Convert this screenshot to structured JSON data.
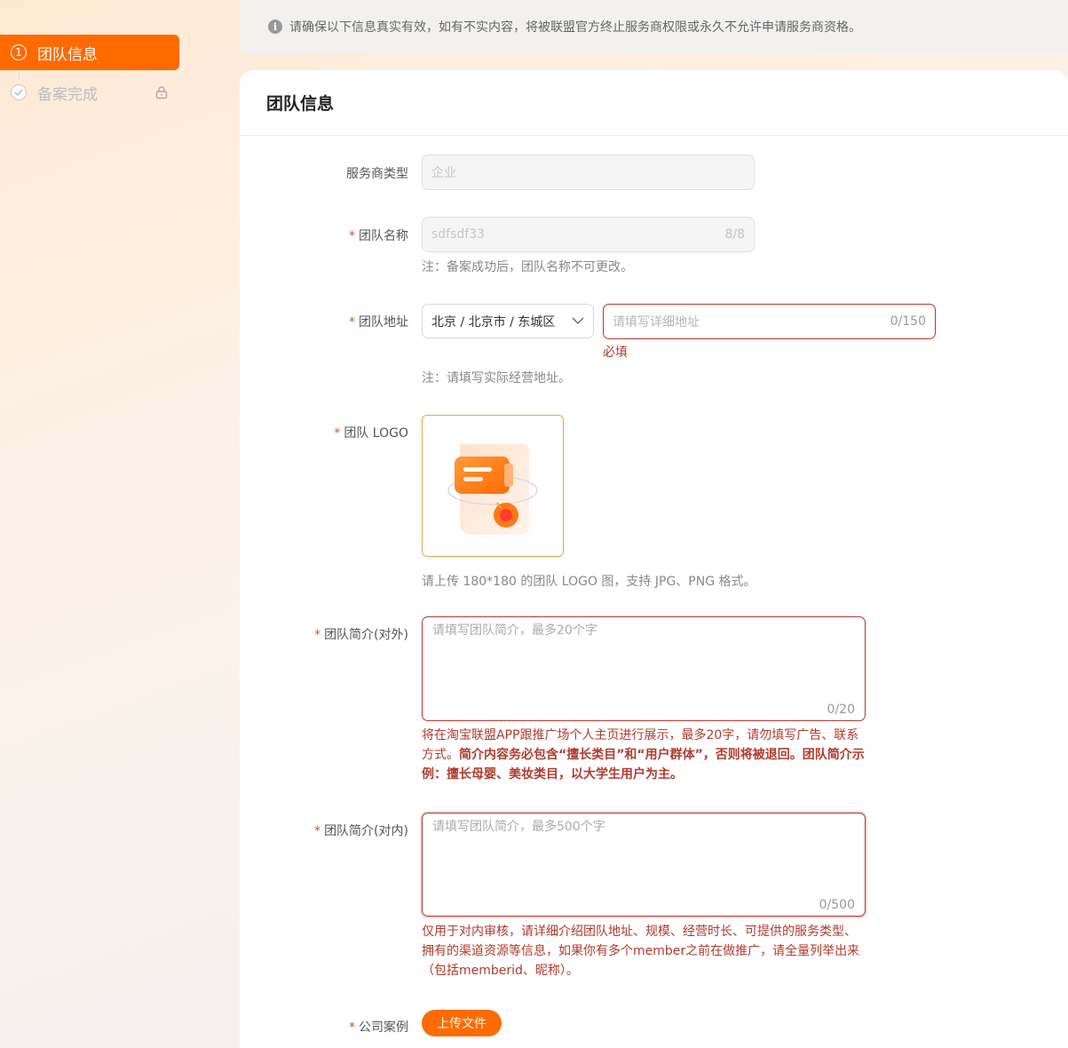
{
  "sidebar": {
    "steps": [
      {
        "num": "1",
        "label": "团队信息",
        "state": "active"
      },
      {
        "label": "备案完成",
        "state": "locked"
      }
    ]
  },
  "notice": {
    "text": "请确保以下信息真实有效，如有不实内容，将被联盟官方终止服务商权限或永久不允许申请服务商资格。"
  },
  "form": {
    "title": "团队信息",
    "provider_type": {
      "label": "服务商类型",
      "value": "企业"
    },
    "team_name": {
      "label": "团队名称",
      "value": "sdfsdf33",
      "count": "8/8",
      "hint": "注：备案成功后，团队名称不可更改。"
    },
    "team_address": {
      "label": "团队地址",
      "region_value": "北京 / 北京市 / 东城区",
      "detail_placeholder": "请填写详细地址",
      "detail_count": "0/150",
      "error": "必填",
      "hint": "注：请填写实际经营地址。"
    },
    "team_logo": {
      "label": "团队 LOGO",
      "hint": "请上传 180*180 的团队 LOGO 图，支持 JPG、PNG 格式。"
    },
    "intro_external": {
      "label": "团队简介(对外)",
      "placeholder": "请填写团队简介，最多20个字",
      "count": "0/20",
      "desc_normal": "将在淘宝联盟APP跟推广场个人主页进行展示，最多20字，请勿填写广告、联系方式。",
      "desc_bold": "简介内容务必包含“擅长类目”和“用户群体”，否则将被退回。团队简介示例：擅长母婴、美妆类目，以大学生用户为主。"
    },
    "intro_internal": {
      "label": "团队简介(对内)",
      "placeholder": "请填写团队简介，最多500个字",
      "count": "0/500",
      "desc": "仅用于对内审核，请详细介绍团队地址、规模、经营时长、可提供的服务类型、拥有的渠道资源等信息，如果你有多个member之前在做推广，请全量列举出来（包括memberid、昵称）。"
    },
    "company_case": {
      "label": "公司案例",
      "upload_label": "上传文件"
    },
    "required_mark": "*"
  },
  "colors": {
    "accent": "#ff6a00",
    "error": "#b03a2e"
  }
}
